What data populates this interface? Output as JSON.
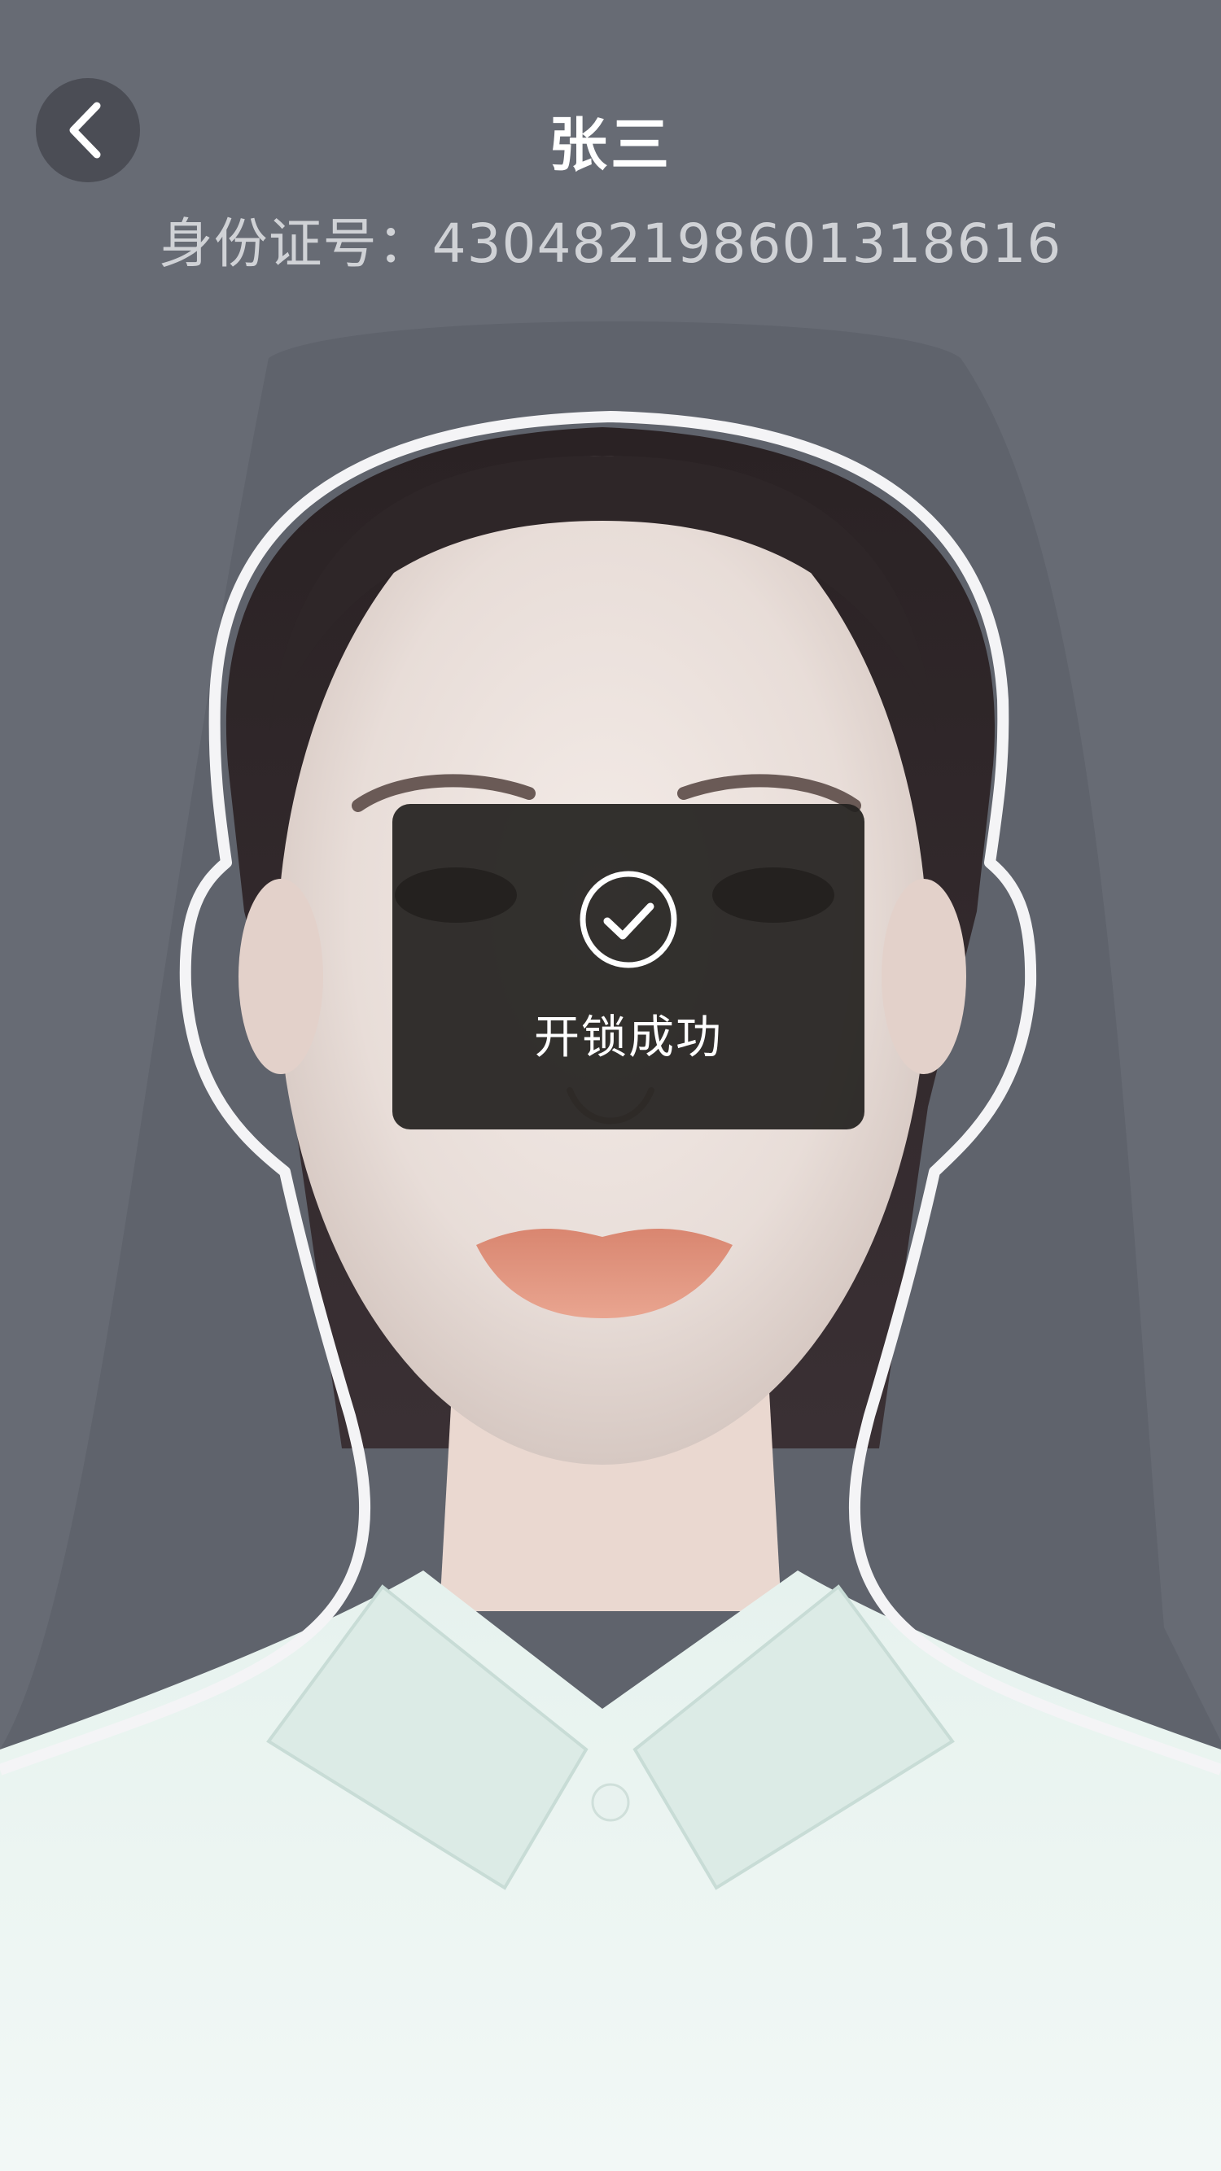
{
  "header": {
    "name": "张三",
    "id_label": "身份证号：",
    "id_number": "430482198601318616"
  },
  "toast": {
    "icon": "check-circle-icon",
    "message": "开锁成功"
  },
  "icons": {
    "back": "chevron-left-icon"
  },
  "colors": {
    "background": "#676b74",
    "overlay_button": "#464850",
    "toast_background": "#24211f",
    "text_primary": "#ffffff",
    "text_secondary": "#d0d2d6",
    "face_outline": "#f4f4f6"
  }
}
